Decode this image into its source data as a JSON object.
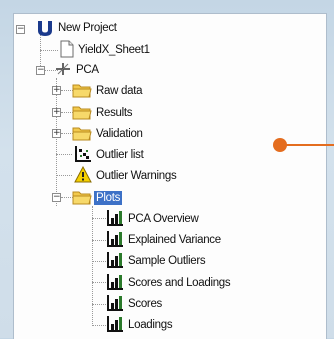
{
  "tree": {
    "root": {
      "label": "New Project",
      "expander": "−"
    },
    "sheet": {
      "label": "YieldX_Sheet1"
    },
    "pca": {
      "label": "PCA",
      "expander": "−"
    },
    "pca_children": [
      {
        "label": "Raw data",
        "expander": "+"
      },
      {
        "label": "Results",
        "expander": "+"
      },
      {
        "label": "Validation",
        "expander": "+"
      },
      {
        "label": "Outlier list"
      },
      {
        "label": "Outlier Warnings"
      },
      {
        "label": "Plots",
        "expander": "−",
        "selected": true
      }
    ],
    "plots_children": [
      {
        "label": "PCA Overview"
      },
      {
        "label": "Explained Variance"
      },
      {
        "label": "Sample Outliers"
      },
      {
        "label": "Scores and Loadings"
      },
      {
        "label": "Scores"
      },
      {
        "label": "Loadings"
      }
    ]
  },
  "colors": {
    "selection": "#3d71c7",
    "marker": "#e46d1f",
    "folder": "#f2c94c",
    "warning": "#f5d000"
  },
  "icons": {
    "root": "project-u-icon",
    "sheet": "document-icon",
    "pca": "model-icon",
    "folder": "folder-icon",
    "outlier_list": "scatter-plot-icon",
    "warning": "warning-icon",
    "plot": "plot-icon"
  }
}
